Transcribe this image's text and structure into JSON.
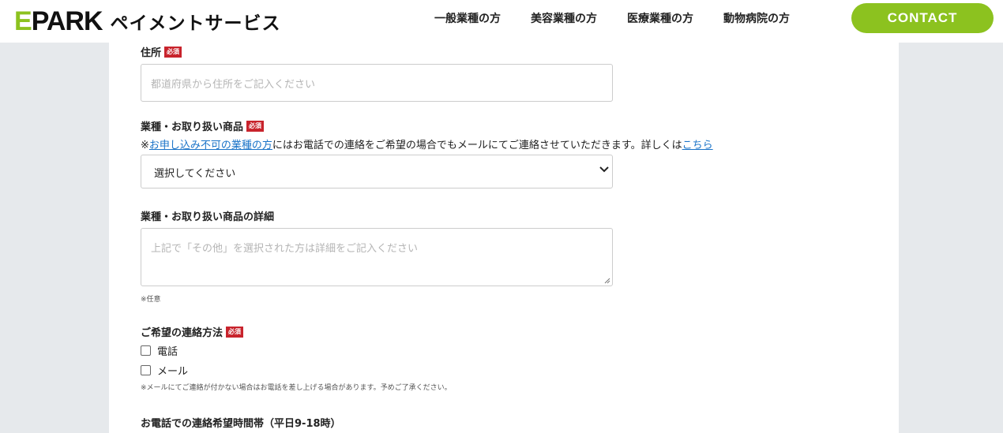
{
  "header": {
    "logo": {
      "brand_e": "E",
      "brand_rest": "PARK",
      "subtitle": "ペイメントサービス"
    },
    "nav": [
      "一般業種の方",
      "美容業種の方",
      "医療業種の方",
      "動物病院の方"
    ],
    "contact_label": "CONTACT",
    "accent_color": "#8cc21f"
  },
  "form": {
    "required_badge": "必須",
    "address": {
      "label": "住所",
      "placeholder": "都道府県から住所をご記入ください"
    },
    "industry": {
      "label": "業種・お取り扱い商品",
      "note_prefix": "※",
      "note_link1": "お申し込み不可の業種の方",
      "note_middle": "にはお電話での連絡をご希望の場合でもメールにてご連絡させていただきます。詳しくは",
      "note_link2": "こちら",
      "select_value": "選択してください"
    },
    "industry_detail": {
      "label": "業種・お取り扱い商品の詳細",
      "placeholder": "上記で「その他」を選択された方は詳細をご記入ください",
      "optional_note": "※任意"
    },
    "contact_method": {
      "label": "ご希望の連絡方法",
      "options": [
        "電話",
        "メール"
      ],
      "note": "※メールにてご連絡が付かない場合はお電話を差し上げる場合があります。予めご了承ください。"
    },
    "phone_time": {
      "label": "お電話での連絡希望時間帯（平日9-18時）"
    }
  }
}
